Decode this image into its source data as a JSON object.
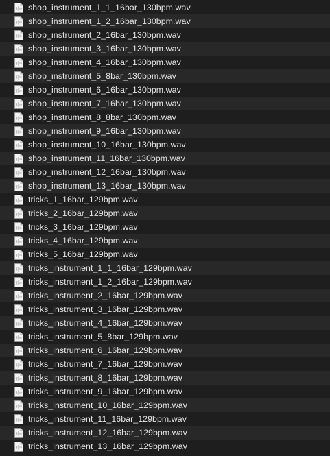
{
  "file_list": {
    "icon": "audio-file-icon",
    "colors": {
      "background": "#1e1e1e",
      "row_alternate": "#282828",
      "text": "#e3e3e3"
    },
    "files": [
      "shop_instrument_1_1_16bar_130bpm.wav",
      "shop_instrument_1_2_16bar_130bpm.wav",
      "shop_instrument_2_16bar_130bpm.wav",
      "shop_instrument_3_16bar_130bpm.wav",
      "shop_instrument_4_16bar_130bpm.wav",
      "shop_instrument_5_8bar_130bpm.wav",
      "shop_instrument_6_16bar_130bpm.wav",
      "shop_instrument_7_16bar_130bpm.wav",
      "shop_instrument_8_8bar_130bpm.wav",
      "shop_instrument_9_16bar_130bpm.wav",
      "shop_instrument_10_16bar_130bpm.wav",
      "shop_instrument_11_16bar_130bpm.wav",
      "shop_instrument_12_16bar_130bpm.wav",
      "shop_instrument_13_16bar_130bpm.wav",
      "tricks_1_16bar_129bpm.wav",
      "tricks_2_16bar_129bpm.wav",
      "tricks_3_16bar_129bpm.wav",
      "tricks_4_16bar_129bpm.wav",
      "tricks_5_16bar_129bpm.wav",
      "tricks_instrument_1_1_16bar_129bpm.wav",
      "tricks_instrument_1_2_16bar_129bpm.wav",
      "tricks_instrument_2_16bar_129bpm.wav",
      "tricks_instrument_3_16bar_129bpm.wav",
      "tricks_instrument_4_16bar_129bpm.wav",
      "tricks_instrument_5_8bar_129bpm.wav",
      "tricks_instrument_6_16bar_129bpm.wav",
      "tricks_instrument_7_16bar_129bpm.wav",
      "tricks_instrument_8_16bar_129bpm.wav",
      "tricks_instrument_9_16bar_129bpm.wav",
      "tricks_instrument_10_16bar_129bpm.wav",
      "tricks_instrument_11_16bar_129bpm.wav",
      "tricks_instrument_12_16bar_129bpm.wav",
      "tricks_instrument_13_16bar_129bpm.wav"
    ]
  }
}
